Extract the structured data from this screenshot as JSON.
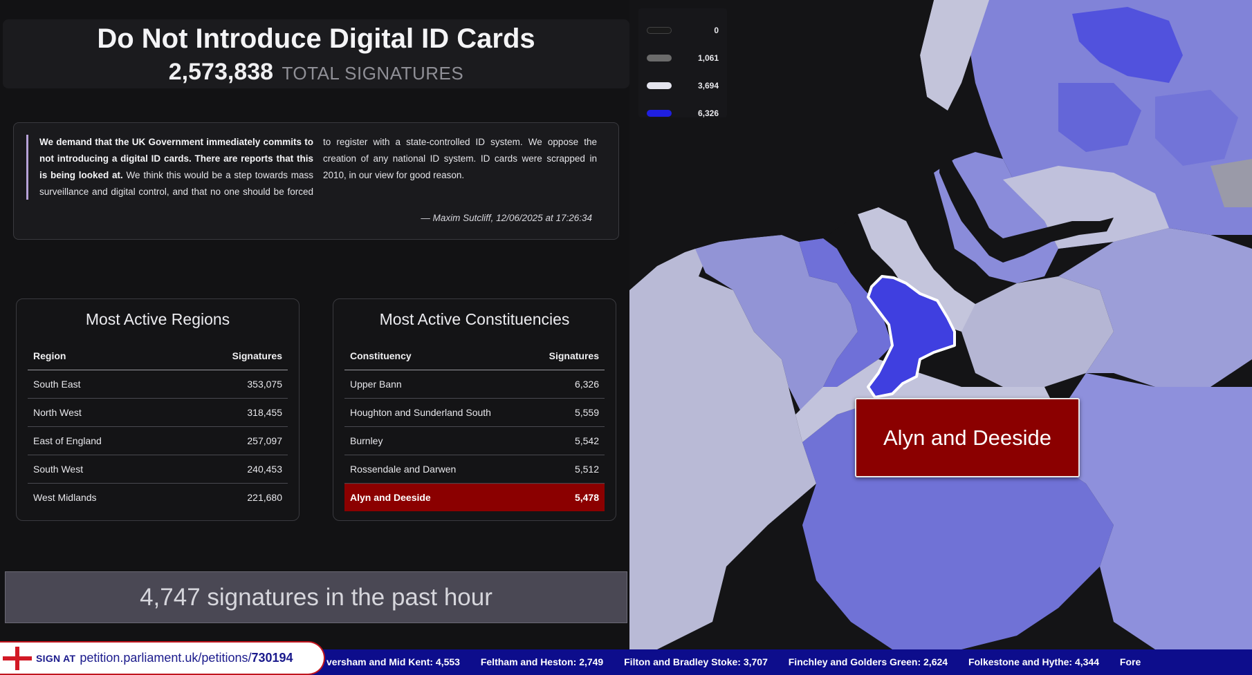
{
  "header": {
    "title": "Do Not Introduce Digital ID Cards",
    "total_signatures": "2,573,838",
    "total_label": "TOTAL SIGNATURES"
  },
  "quote": {
    "bold": "We demand that the UK Government immediately commits to not introducing a digital ID cards. There are reports that this is being looked at.",
    "text": " We think this would be a step towards mass surveillance and digital control, and that no one should be forced to register with a state-controlled ID system. We oppose the creation of any national ID system. ID cards were scrapped in 2010, in our view for good reason.",
    "attribution": "— Maxim Sutcliff, 12/06/2025 at 17:26:34"
  },
  "legend": [
    {
      "value": "0",
      "color": "#1a1a1a"
    },
    {
      "value": "1,061",
      "color": "#6b6b6b"
    },
    {
      "value": "3,694",
      "color": "#e4e4ee"
    },
    {
      "value": "6,326",
      "color": "#1f1fe0"
    }
  ],
  "regions": {
    "title": "Most Active Regions",
    "col_name": "Region",
    "col_value": "Signatures",
    "rows": [
      {
        "name": "South East",
        "value": "353,075"
      },
      {
        "name": "North West",
        "value": "318,455"
      },
      {
        "name": "East of England",
        "value": "257,097"
      },
      {
        "name": "South West",
        "value": "240,453"
      },
      {
        "name": "West Midlands",
        "value": "221,680"
      }
    ]
  },
  "constituencies": {
    "title": "Most Active Constituencies",
    "col_name": "Constituency",
    "col_value": "Signatures",
    "rows": [
      {
        "name": "Upper Bann",
        "value": "6,326"
      },
      {
        "name": "Houghton and Sunderland South",
        "value": "5,559"
      },
      {
        "name": "Burnley",
        "value": "5,542"
      },
      {
        "name": "Rossendale and Darwen",
        "value": "5,512"
      },
      {
        "name": "Alyn and Deeside",
        "value": "5,478"
      }
    ],
    "highlighted_index": 4
  },
  "past_hour": "4,747 signatures in the past hour",
  "tooltip": "Alyn and Deeside",
  "ticker": [
    "versham and Mid Kent: 4,553",
    "Feltham and Heston: 2,749",
    "Filton and Bradley Stoke: 3,707",
    "Finchley and Golders Green: 2,624",
    "Folkestone and Hythe: 4,344",
    "Fore"
  ],
  "sign": {
    "label": "SIGN AT",
    "url_base": "petition.parliament.uk/petitions/",
    "petition_id": "730194"
  },
  "colors": {
    "highlight": "#8b0000",
    "ticker_bg": "#0d0d8c",
    "quote_bar": "#b7a2d8"
  }
}
